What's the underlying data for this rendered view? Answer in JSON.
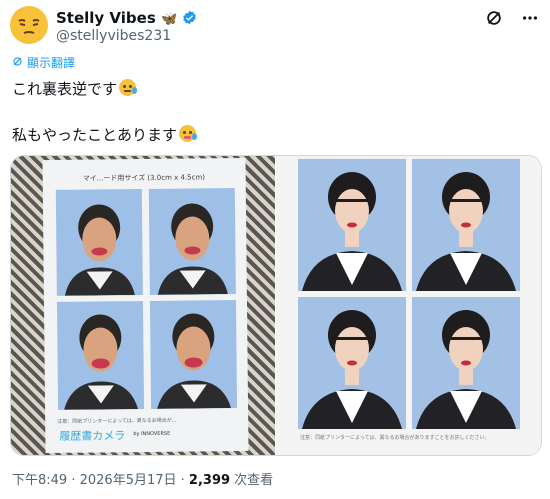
{
  "header": {
    "display_name": "Stelly Vibes",
    "handle": "@stellyvibes231",
    "butterfly_icon": "butterfly-emoji",
    "verified_icon": "verified-badge-icon",
    "grok_icon": "grok-icon",
    "more_icon": "more-icon"
  },
  "translate": {
    "label": "顯示翻譯"
  },
  "post": {
    "line1": "これ裏表逆です",
    "line2": "私もやったことあります"
  },
  "media": {
    "left_photo": {
      "top_text": "マイ...ード用サイズ (3.0cm x 4.5cm)",
      "footnote": "注意：同紙プリンターによっては、異なるお場合が...",
      "brand": "履歴書カメラ",
      "brand_small": "by INNOVERSE"
    },
    "right_photo": {
      "footnote": "注意：同紙プリンターによっては、異なるお場合がありますことをお許しください。"
    }
  },
  "meta": {
    "time": "下午8:49",
    "sep1": " · ",
    "date": "2026年5月17日",
    "sep2": " · ",
    "views": "2,399",
    "views_label": " 次查看"
  },
  "colors": {
    "accent": "#1d9bf0",
    "secondary_text": "#536471",
    "bg": "#ffffff"
  }
}
